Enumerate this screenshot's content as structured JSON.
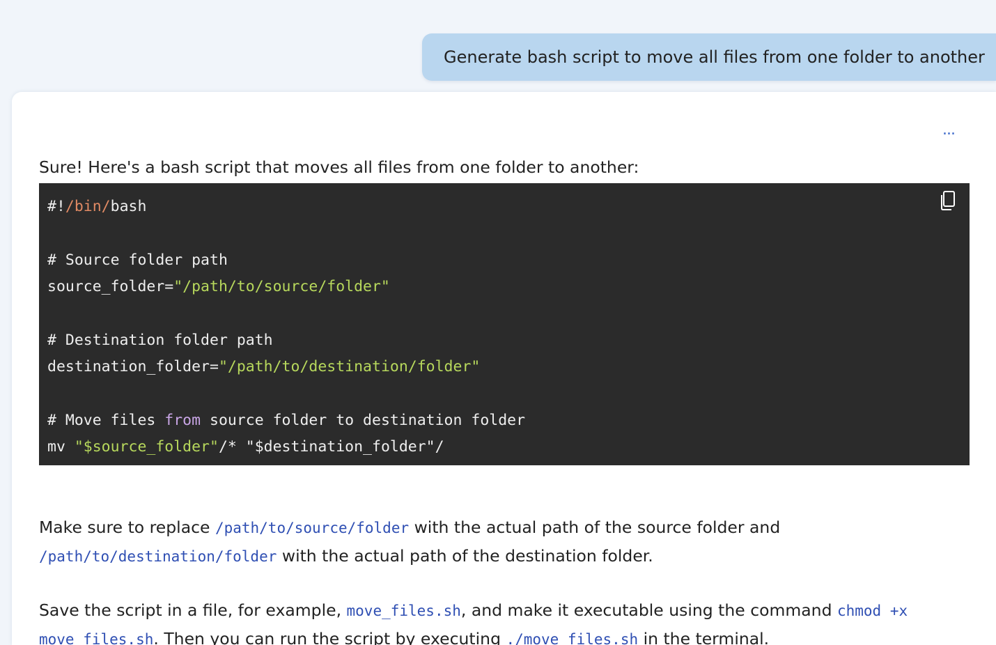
{
  "user_message": {
    "text": "Generate bash script to move all files from one folder to another"
  },
  "assistant": {
    "more_label": "...",
    "intro": "Sure! Here's a bash script that moves all files from one folder to another:",
    "code_lines": [
      {
        "segments": [
          {
            "text": "#!",
            "kind": "plain"
          },
          {
            "text": "/bin/",
            "kind": "path"
          },
          {
            "text": "bash",
            "kind": "plain"
          }
        ]
      },
      {
        "segments": []
      },
      {
        "segments": [
          {
            "text": "# Source folder path",
            "kind": "plain"
          }
        ]
      },
      {
        "segments": [
          {
            "text": "source_folder=",
            "kind": "plain"
          },
          {
            "text": "\"/path/to/source/folder\"",
            "kind": "str"
          }
        ]
      },
      {
        "segments": []
      },
      {
        "segments": [
          {
            "text": "# Destination folder path",
            "kind": "plain"
          }
        ]
      },
      {
        "segments": [
          {
            "text": "destination_folder=",
            "kind": "plain"
          },
          {
            "text": "\"/path/to/destination/folder\"",
            "kind": "str"
          }
        ]
      },
      {
        "segments": []
      },
      {
        "segments": [
          {
            "text": "# Move files ",
            "kind": "plain"
          },
          {
            "text": "from",
            "kind": "kw"
          },
          {
            "text": " source folder to destination folder",
            "kind": "plain"
          }
        ]
      },
      {
        "segments": [
          {
            "text": "mv ",
            "kind": "plain"
          },
          {
            "text": "\"$source_folder\"",
            "kind": "str"
          },
          {
            "text": "/* \"$destination_folder\"/",
            "kind": "plain"
          }
        ]
      }
    ],
    "para1": {
      "line1": {
        "t1": "Make sure to replace ",
        "c1": "/path/to/source/folder",
        "t2": " with the actual path of the source folder and"
      },
      "line2": {
        "c1": "/path/to/destination/folder",
        "t1": " with the actual path of the destination folder."
      }
    },
    "para2": {
      "line1": {
        "t1": "Save the script in a file, for example, ",
        "c1": "move_files.sh",
        "t2": ", and make it executable using the command ",
        "c2": "chmod +x"
      },
      "line2": {
        "c1": "move_files.sh",
        "t1": ". Then you can run the script by executing ",
        "c2": "./move_files.sh",
        "t2": " in the terminal."
      }
    }
  },
  "colors": {
    "page_background": "#f1f5fa",
    "user_bubble": "#b9d6ef",
    "code_background": "#2b2b2b",
    "inline_code": "#2f4fb3",
    "string_token": "#b7d85c",
    "path_token": "#e08a64",
    "keyword_token": "#c9a6e6",
    "accent": "#3b68c9"
  },
  "icons": {
    "copy": "copy-icon",
    "more": "more-icon"
  }
}
